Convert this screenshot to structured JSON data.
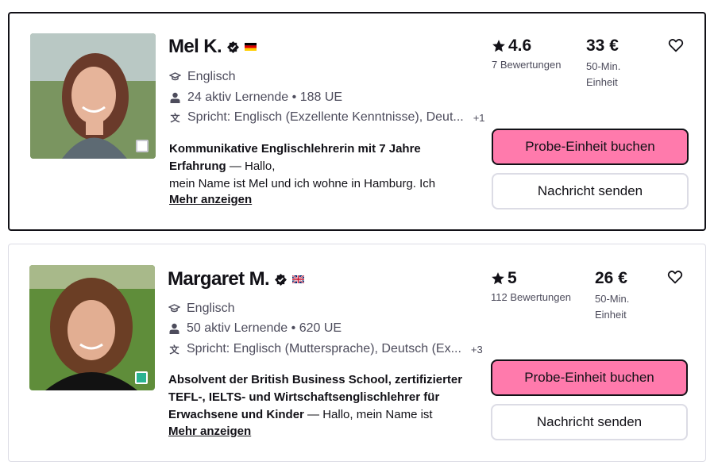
{
  "tutors": [
    {
      "name": "Mel K.",
      "verified_icon": "verified-badge-icon",
      "flag": "german-flag",
      "subject": "Englisch",
      "learners": "24 aktiv Lernende • 188 UE",
      "speaks": "Spricht: Englisch (Exzellente Kenntnisse), Deut...",
      "speaks_more": "+1",
      "headline": "Kommunikative Englischlehrerin mit 7 Jahre Erfahrung",
      "intro": " — Hallo,",
      "intro2": "mein Name ist Mel und ich wohne in Hamburg. Ich",
      "more_label": "Mehr anzeigen",
      "rating": "4.6",
      "reviews": "7 Bewertungen",
      "price": "33 €",
      "price_unit": "50-Min. Einheit",
      "book_label": "Probe-Einheit buchen",
      "message_label": "Nachricht senden",
      "status_color": "#ffffff"
    },
    {
      "name": "Margaret M.",
      "verified_icon": "verified-badge-icon",
      "flag": "uk-flag",
      "subject": "Englisch",
      "learners": "50 aktiv Lernende • 620 UE",
      "speaks": "Spricht: Englisch (Muttersprache), Deutsch (Ex...",
      "speaks_more": "+3",
      "headline": "Absolvent der British Business School, zertifizierter TEFL-, IELTS- und Wirtschaftsenglischlehrer für Erwachsene und Kinder",
      "intro": " — Hallo, mein Name ist",
      "intro2": "",
      "more_label": "Mehr anzeigen",
      "rating": "5",
      "reviews": "112 Bewertungen",
      "price": "26 €",
      "price_unit": "50-Min. Einheit",
      "book_label": "Probe-Einheit buchen",
      "message_label": "Nachricht senden",
      "status_color": "#2bb391"
    }
  ],
  "colors": {
    "accent": "#ff7aac",
    "text": "#121117",
    "muted": "#4d4c5c",
    "border": "#dcdce5"
  }
}
